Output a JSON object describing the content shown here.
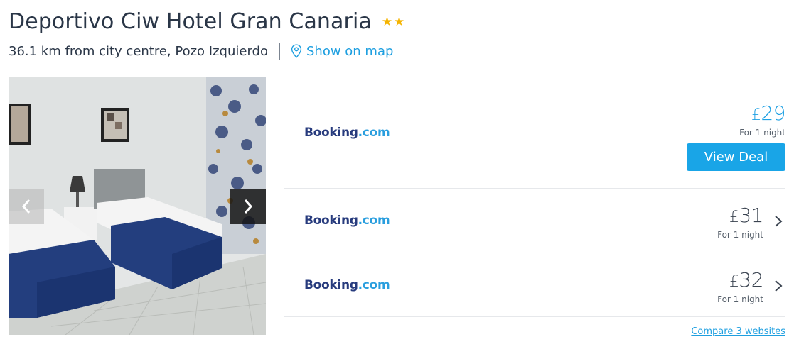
{
  "hotel": {
    "name": "Deportivo Ciw Hotel Gran Canaria",
    "star_rating": 2,
    "star_color": "#f5b400",
    "distance": "36.1 km from city centre, Pozo Izquierdo",
    "map_link": "Show on map",
    "map_icon": "location-pin-icon"
  },
  "gallery": {
    "prev_icon": "chevron-left-icon",
    "next_icon": "chevron-right-icon"
  },
  "deals": [
    {
      "provider_part1": "Booking",
      "provider_part2": ".com",
      "currency": "£",
      "price": "29",
      "per_night": "For 1 night",
      "cta": "View Deal",
      "featured": true
    },
    {
      "provider_part1": "Booking",
      "provider_part2": ".com",
      "currency": "£",
      "price": "31",
      "per_night": "For 1 night",
      "featured": false
    },
    {
      "provider_part1": "Booking",
      "provider_part2": ".com",
      "currency": "£",
      "price": "32",
      "per_night": "For 1 night",
      "featured": false
    }
  ],
  "compare_link": "Compare 3 websites",
  "colors": {
    "accent": "#19a5e7",
    "link": "#1e9fe0",
    "booking_dark": "#273b7d",
    "booking_light": "#2a9ede"
  }
}
